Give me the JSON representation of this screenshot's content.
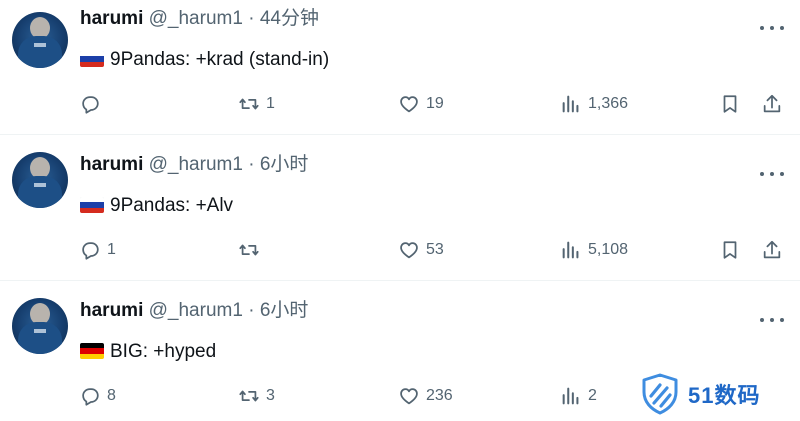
{
  "tweets": [
    {
      "display_name": "harumi",
      "handle": "@_harum1",
      "separator": "·",
      "time": "44分钟",
      "flag": "russia",
      "text": "9Pandas: +krad (stand-in)",
      "replies": "",
      "retweets": "1",
      "likes": "19",
      "views": "1,366"
    },
    {
      "display_name": "harumi",
      "handle": "@_harum1",
      "separator": "·",
      "time": "6小时",
      "flag": "russia",
      "text": "9Pandas: +Alv",
      "replies": "1",
      "retweets": "",
      "likes": "53",
      "views": "5,108"
    },
    {
      "display_name": "harumi",
      "handle": "@_harum1",
      "separator": "·",
      "time": "6小时",
      "flag": "germany",
      "text": "BIG: +hyped",
      "replies": "8",
      "retweets": "3",
      "likes": "236",
      "views": "2"
    }
  ],
  "icons": {
    "reply": "reply-icon",
    "retweet": "retweet-icon",
    "like": "like-icon",
    "views": "views-icon",
    "bookmark": "bookmark-icon",
    "share": "share-icon",
    "more": "more-icon"
  },
  "watermark": {
    "text": "51数码"
  },
  "colors": {
    "text": "#0f1419",
    "secondary": "#536471",
    "divider": "#eff3f4",
    "watermark": "#1f68c7"
  }
}
